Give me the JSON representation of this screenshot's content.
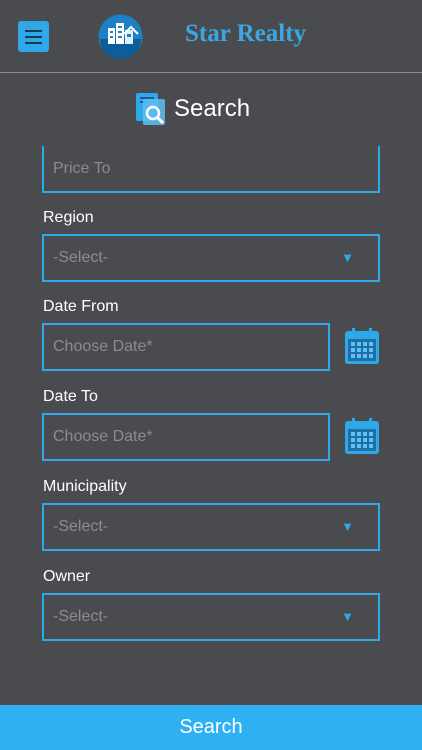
{
  "header": {
    "brand": "Star Realty",
    "menu_icon": "hamburger-menu-icon",
    "logo_icon": "building-logo-icon"
  },
  "search_section": {
    "title": "Search",
    "icon": "document-search-icon"
  },
  "form": {
    "price_to": {
      "placeholder": "Price To"
    },
    "region": {
      "label": "Region",
      "value": "-Select-"
    },
    "date_from": {
      "label": "Date From",
      "placeholder": "Choose Date*"
    },
    "date_to": {
      "label": "Date To",
      "placeholder": "Choose Date*"
    },
    "municipality": {
      "label": "Municipality",
      "value": "-Select-"
    },
    "owner": {
      "label": "Owner",
      "value": "-Select-"
    }
  },
  "footer": {
    "search_label": "Search"
  },
  "colors": {
    "accent": "#2fa8ea",
    "background": "#4a4b4e",
    "footer": "#2fb0f3"
  }
}
